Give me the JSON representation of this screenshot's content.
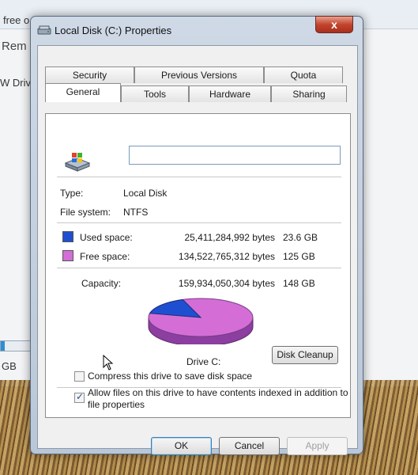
{
  "background": {
    "fragments": [
      "free o",
      "Rem",
      "W Driv",
      "GB"
    ],
    "progress": 0.1
  },
  "dialog": {
    "title": "Local Disk (C:) Properties",
    "close_glyph": "x",
    "tabs_back": [
      "Security",
      "Previous Versions",
      "Quota"
    ],
    "tabs_front": [
      "General",
      "Tools",
      "Hardware",
      "Sharing"
    ],
    "active_tab": "General",
    "drive_name_value": "",
    "type_label": "Type:",
    "type_value": "Local Disk",
    "fs_label": "File system:",
    "fs_value": "NTFS",
    "used": {
      "label": "Used space:",
      "bytes": "25,411,284,992 bytes",
      "size": "23.6 GB",
      "color": "#1f4fd1"
    },
    "free": {
      "label": "Free space:",
      "bytes": "134,522,765,312 bytes",
      "size": "125 GB",
      "color": "#d46ed6"
    },
    "capacity": {
      "label": "Capacity:",
      "bytes": "159,934,050,304 bytes",
      "size": "148 GB"
    },
    "used_fraction": 0.159,
    "drive_label": "Drive C:",
    "disk_cleanup": "Disk Cleanup",
    "compress_label": "Compress this drive to save disk space",
    "compress_checked": false,
    "index_label_1": "Allow files on this drive to have contents indexed in addition to",
    "index_label_2": "file properties",
    "index_checked": true,
    "ok": "OK",
    "cancel": "Cancel",
    "apply": "Apply"
  }
}
